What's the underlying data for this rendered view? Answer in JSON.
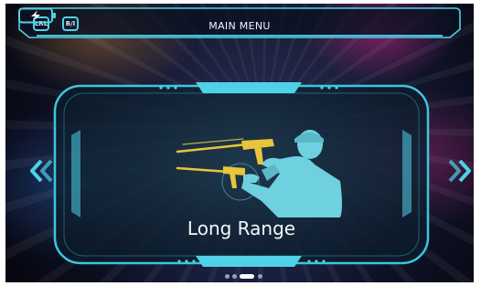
{
  "header": {
    "title": "MAIN MENU",
    "left_chips": [
      "LRL",
      "B/I"
    ],
    "battery_icon": "battery-charging-icon"
  },
  "carousel": {
    "current_mode": "Long Range",
    "mode_icon": "soldier-aiming-rifle-icon",
    "page_count": 4,
    "active_page": 3,
    "prev_icon": "double-chevron-left-icon",
    "next_icon": "double-chevron-right-icon"
  },
  "colors": {
    "accent": "#4fd2e6",
    "gun_yellow": "#e8c53a",
    "silhouette": "#6fd0df"
  }
}
